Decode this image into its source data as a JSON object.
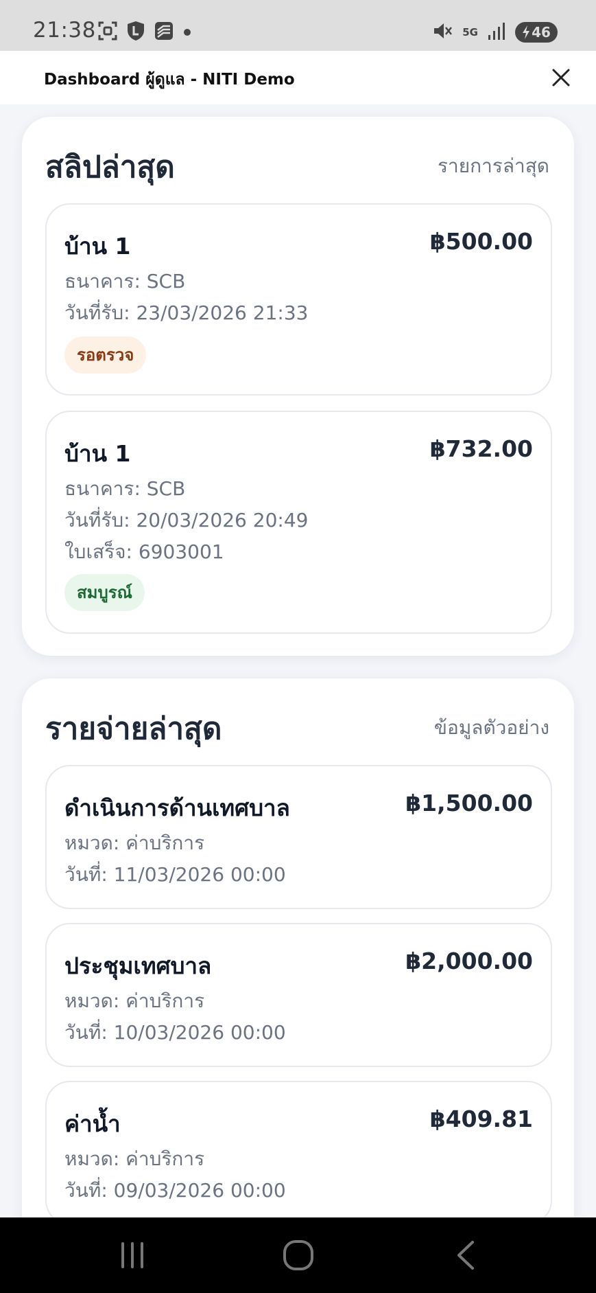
{
  "status_bar": {
    "time": "21:38",
    "network": "5G",
    "battery_level": "46",
    "icons_left": [
      "screenshot-icon",
      "shield-icon",
      "layers-icon",
      "dot-icon"
    ],
    "icons_right": [
      "mute-icon",
      "signal-icon",
      "battery-icon"
    ]
  },
  "app_bar": {
    "title": "Dashboard ผู้ดูแล - NITI Demo"
  },
  "slips": {
    "title": "สลิปล่าสุด",
    "subtitle": "รายการล่าสุด",
    "items": [
      {
        "title": "บ้าน 1",
        "amount": "฿500.00",
        "bank": "ธนาคาร: SCB",
        "received": "วันที่รับ: 23/03/2026 21:33",
        "status": "รอตรวจ"
      },
      {
        "title": "บ้าน 1",
        "amount": "฿732.00",
        "bank": "ธนาคาร: SCB",
        "received": "วันที่รับ: 20/03/2026 20:49",
        "receipt": "ใบเสร็จ: 6903001",
        "status": "สมบูรณ์"
      }
    ]
  },
  "expenses": {
    "title": "รายจ่ายล่าสุด",
    "subtitle": "ข้อมูลตัวอย่าง",
    "items": [
      {
        "title": "ดำเนินการด้านเทศบาล",
        "amount": "฿1,500.00",
        "category": "หมวด: ค่าบริการ",
        "date": "วันที่: 11/03/2026 00:00"
      },
      {
        "title": "ประชุมเทศบาล",
        "amount": "฿2,000.00",
        "category": "หมวด: ค่าบริการ",
        "date": "วันที่: 10/03/2026 00:00"
      },
      {
        "title": "ค่าน้ำ",
        "amount": "฿409.81",
        "category": "หมวด: ค่าบริการ",
        "date": "วันที่: 09/03/2026 00:00"
      }
    ]
  },
  "colors": {
    "pending_badge_bg": "#fdf1e6",
    "pending_badge_text": "#8a3a12",
    "done_badge_bg": "#e8f6ec",
    "done_badge_text": "#1e6a36"
  }
}
